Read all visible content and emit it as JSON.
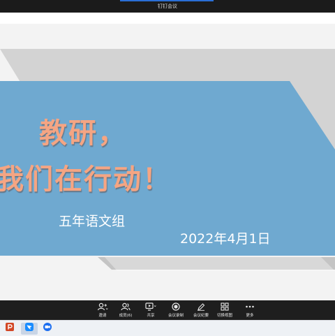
{
  "window": {
    "title": "钉钉会议"
  },
  "slide": {
    "title_line1": "教研，",
    "title_line2": "我们在行动！",
    "subtitle": "五年语文组",
    "date": "2022年4月1日"
  },
  "toolbar": {
    "items": [
      {
        "label": "邀请",
        "icon": "invite-icon"
      },
      {
        "label": "成员(6)",
        "icon": "members-icon"
      },
      {
        "label": "共享",
        "icon": "share-screen-icon"
      },
      {
        "label": "会议录制",
        "icon": "record-icon"
      },
      {
        "label": "会议纪要",
        "icon": "minutes-icon"
      },
      {
        "label": "切换视图",
        "icon": "grid-view-icon"
      },
      {
        "label": "更多",
        "icon": "more-icon"
      }
    ]
  },
  "taskbar": {
    "apps": [
      {
        "name": "powerpoint",
        "icon": "powerpoint-icon",
        "color": "#d24726"
      },
      {
        "name": "dingtalk",
        "icon": "dingtalk-icon",
        "color": "#1a8cff"
      },
      {
        "name": "meeting",
        "icon": "video-meeting-icon",
        "color": "#1e6ff0"
      }
    ]
  },
  "colors": {
    "slide_blue": "#6fa9d0",
    "title_orange": "#f5a583",
    "slide_gray": "#d3d3d3",
    "toolbar_bg": "#1e1e1e"
  }
}
